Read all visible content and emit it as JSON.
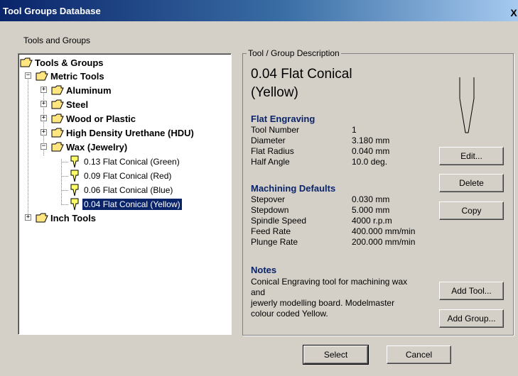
{
  "window": {
    "title": "Tool Groups Database",
    "close_glyph": "X"
  },
  "left_panel": {
    "label": "Tools and Groups"
  },
  "tree": {
    "root_label": "Tools & Groups",
    "metric_label": "Metric Tools",
    "groups": [
      "Aluminum",
      "Steel",
      "Wood or Plastic",
      "High Density Urethane (HDU)",
      "Wax (Jewelry)"
    ],
    "tools": [
      "0.13 Flat Conical  (Green)",
      "0.09 Flat Conical  (Red)",
      "0.06 Flat Conical  (Blue)",
      "0.04 Flat Conical  (Yellow)"
    ],
    "inch_label": "Inch Tools",
    "expand_glyph": "+",
    "collapse_glyph": "−"
  },
  "description": {
    "group_title": "Tool / Group Description",
    "tool_name_line1": "0.04 Flat Conical",
    "tool_name_line2": "(Yellow)",
    "flat_engraving": {
      "heading": "Flat Engraving",
      "rows": [
        {
          "label": "Tool Number",
          "value": "1"
        },
        {
          "label": "Diameter",
          "value": "3.180 mm"
        },
        {
          "label": "Flat Radius",
          "value": "0.040 mm"
        },
        {
          "label": "Half Angle",
          "value": "10.0 deg."
        }
      ]
    },
    "machining_defaults": {
      "heading": "Machining Defaults",
      "rows": [
        {
          "label": "Stepover",
          "value": "0.030 mm"
        },
        {
          "label": "Stepdown",
          "value": "5.000 mm"
        },
        {
          "label": "Spindle Speed",
          "value": "4000 r.p.m"
        },
        {
          "label": "Feed Rate",
          "value": "400.000 mm/min"
        },
        {
          "label": "Plunge Rate",
          "value": "200.000 mm/min"
        }
      ]
    },
    "notes": {
      "heading": "Notes",
      "lines": [
        "Conical Engraving tool for machining wax",
        "and",
        "jewerly modelling board. Modelmaster",
        "colour coded Yellow."
      ]
    }
  },
  "buttons": {
    "edit": "Edit...",
    "delete": "Delete",
    "copy": "Copy",
    "add_tool": "Add Tool...",
    "add_group": "Add Group...",
    "select": "Select",
    "cancel": "Cancel"
  },
  "colors": {
    "tool_yellow": "#ffff00",
    "folder_yellow": "#ffe680",
    "heading_blue": "#0a246a",
    "selection": "#0a246a"
  }
}
